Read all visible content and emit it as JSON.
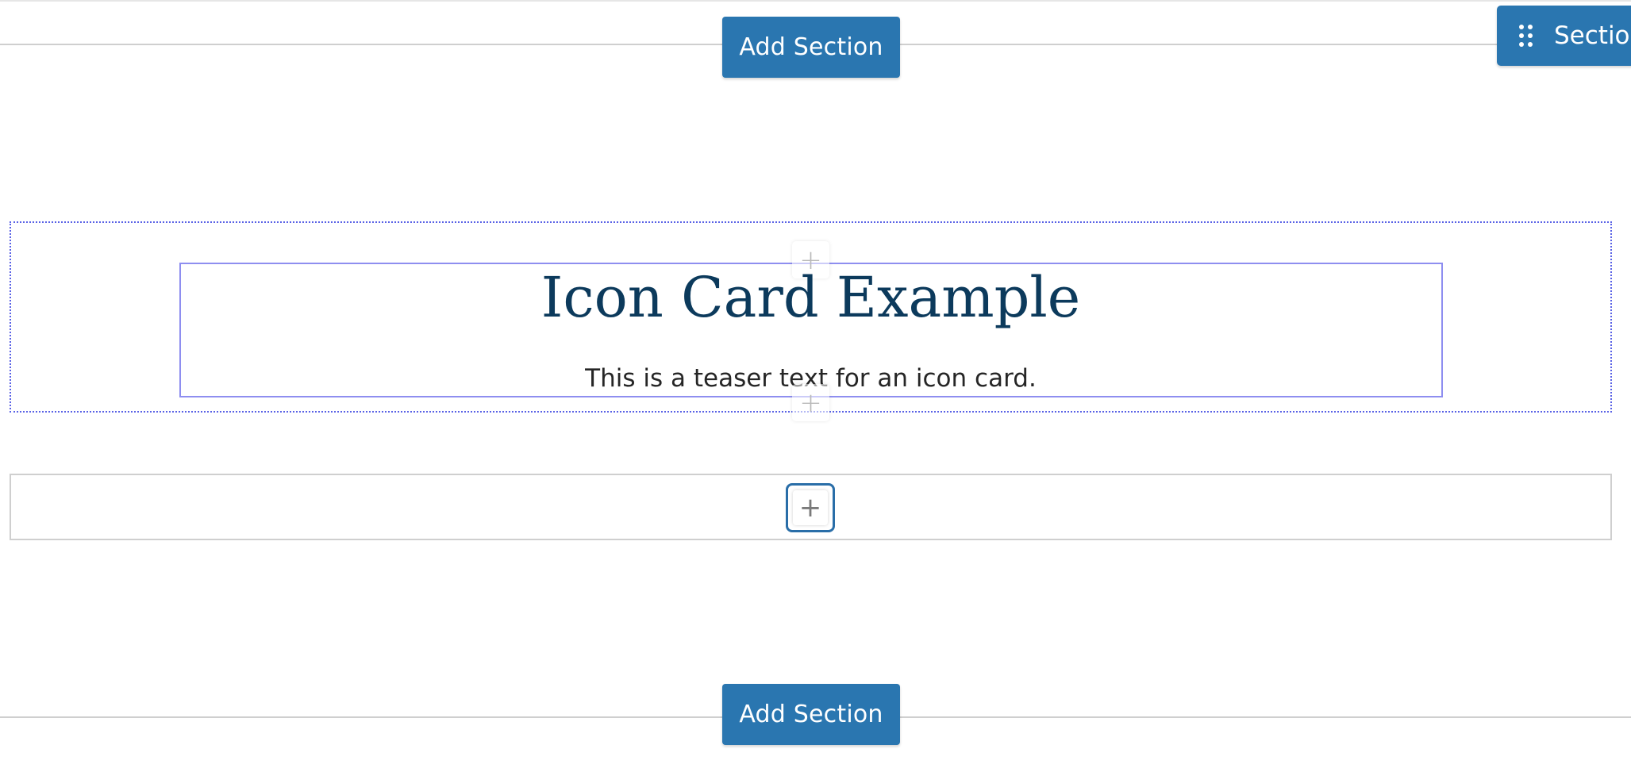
{
  "toolbar": {
    "add_section_top_label": "Add Section",
    "add_section_bottom_label": "Add Section",
    "section_tab_label": "Section"
  },
  "card": {
    "title": "Icon Card Example",
    "teaser": "This is a teaser text for an icon card."
  },
  "icons": {
    "drag": "drag-handle-icon",
    "add_block": "plus-icon",
    "plus_glyph": "+"
  },
  "colors": {
    "accent": "#2a76b0",
    "title_text": "#0c3a5c",
    "selected_outline": "#5a62e6",
    "block_outline": "#8e8ef0",
    "focus_ring": "#2a6ea8",
    "divider": "#cfcfcf"
  }
}
